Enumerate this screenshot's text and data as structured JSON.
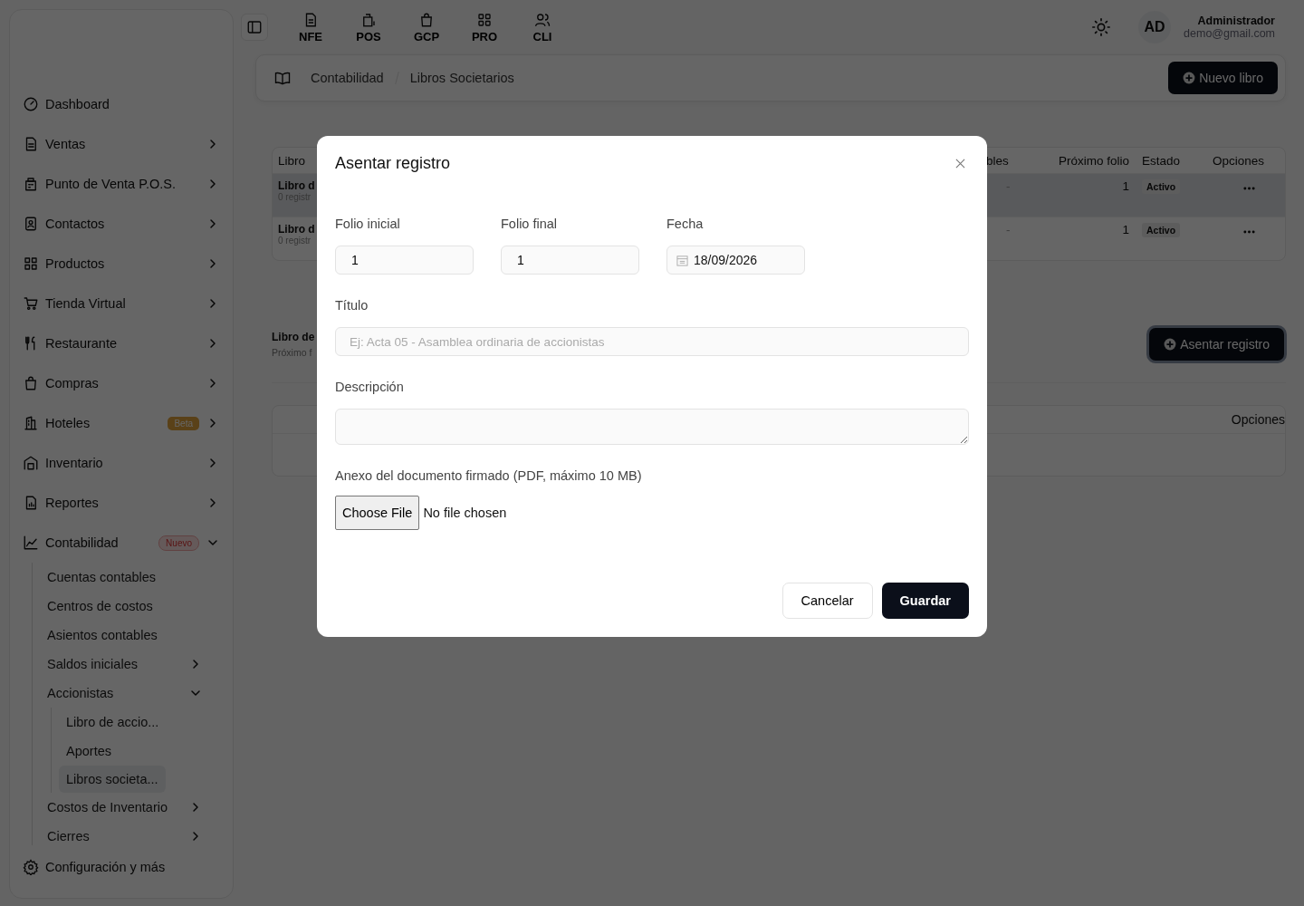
{
  "sidebar": {
    "items": [
      {
        "label": "Dashboard"
      },
      {
        "label": "Ventas",
        "expanded": false
      },
      {
        "label": "Punto de Venta P.O.S.",
        "expanded": false
      },
      {
        "label": "Contactos",
        "expanded": false
      },
      {
        "label": "Productos",
        "expanded": false
      },
      {
        "label": "Tienda Virtual",
        "expanded": false
      },
      {
        "label": "Restaurante",
        "expanded": false
      },
      {
        "label": "Compras",
        "expanded": false
      },
      {
        "label": "Hoteles",
        "expanded": false,
        "badge": {
          "text": "Beta",
          "kind": "beta"
        }
      },
      {
        "label": "Inventario",
        "expanded": false
      },
      {
        "label": "Reportes",
        "expanded": false
      },
      {
        "label": "Contabilidad",
        "expanded": true,
        "badge": {
          "text": "Nuevo",
          "kind": "new"
        },
        "children": [
          {
            "label": "Cuentas contables",
            "selected": false
          },
          {
            "label": "Centros de costos",
            "selected": false
          },
          {
            "label": "Asientos contables",
            "selected": false
          },
          {
            "label": "Saldos iniciales",
            "selected": false,
            "expanded": false
          },
          {
            "label": "Accionistas",
            "selected": false,
            "expanded": true,
            "children": [
              {
                "label": "Libro de accio...",
                "selected": false
              },
              {
                "label": "Aportes",
                "selected": false
              },
              {
                "label": "Libros societa...",
                "selected": true
              }
            ]
          },
          {
            "label": "Costos de Inventario",
            "selected": false,
            "expanded": false
          },
          {
            "label": "Cierres",
            "selected": false,
            "expanded": false
          }
        ]
      }
    ],
    "footer": "Configuración y más"
  },
  "apps": [
    {
      "label": "NFE"
    },
    {
      "label": "POS"
    },
    {
      "label": "GCP"
    },
    {
      "label": "PRO"
    },
    {
      "label": "CLI"
    }
  ],
  "user": {
    "initials": "AD",
    "name": "Administrador",
    "email": "demo@gmail.com"
  },
  "breadcrumb": [
    "Contabilidad",
    "Libros Societarios"
  ],
  "new_button": "Nuevo libro",
  "books_table": {
    "columns": [
      "Libro",
      "bles",
      "Próximo folio",
      "Estado",
      "Opciones"
    ],
    "rows": [
      {
        "title": "Libro d",
        "subtitle": "0 registr",
        "column_2": "-",
        "next_folio": "1",
        "status": "Activo",
        "selected": true
      },
      {
        "title": "Libro d",
        "subtitle": "0 registr",
        "column_2": "-",
        "next_folio": "1",
        "status": "Activo",
        "selected": false
      }
    ]
  },
  "detail": {
    "title": "Libro de",
    "subtitle": "Próximo f",
    "button": "Asentar registro",
    "table": {
      "columns": [
        "Opciones"
      ]
    }
  },
  "modal": {
    "title": "Asentar registro",
    "folio_start": {
      "label": "Folio inicial",
      "value": "1"
    },
    "folio_end": {
      "label": "Folio final",
      "value": "1"
    },
    "date": {
      "label": "Fecha",
      "value": "18/09/2026"
    },
    "title_field": {
      "label": "Título",
      "placeholder": "Ej: Acta 05 - Asamblea ordinaria de accionistas"
    },
    "description": {
      "label": "Descripción"
    },
    "attachment": {
      "label": "Anexo del documento firmado (PDF, máximo 10 MB)",
      "button": "Choose File",
      "status": "No file chosen"
    },
    "buttons": {
      "cancel": "Cancelar",
      "save": "Guardar"
    }
  }
}
